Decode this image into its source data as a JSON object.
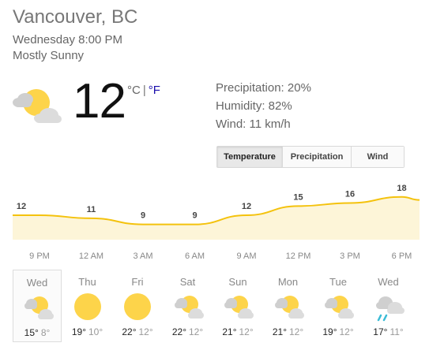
{
  "location": "Vancouver, BC",
  "datetime": "Wednesday 8:00 PM",
  "condition": "Mostly Sunny",
  "current": {
    "temp": "12",
    "unit_c": "°C",
    "unit_sep": "|",
    "unit_f": "°F",
    "icon": "partly-sunny-icon"
  },
  "details": {
    "precipitation": "Precipitation: 20%",
    "humidity": "Humidity: 82%",
    "wind": "Wind: 11 km/h"
  },
  "tabs": [
    {
      "label": "Temperature",
      "active": true
    },
    {
      "label": "Precipitation",
      "active": false
    },
    {
      "label": "Wind",
      "active": false
    }
  ],
  "chart_data": {
    "type": "area",
    "x": [
      "9 PM",
      "12 AM",
      "3 AM",
      "6 AM",
      "9 AM",
      "12 PM",
      "3 PM",
      "6 PM"
    ],
    "labeled_points": [
      {
        "x": "9 PM",
        "label": "12",
        "y": 12
      },
      {
        "x": "12 AM",
        "label": "11",
        "y": 11
      },
      {
        "x": "3 AM",
        "label": "9",
        "y": 9
      },
      {
        "x": "6 AM",
        "label": "9",
        "y": 9
      },
      {
        "x": "9 AM",
        "label": "12",
        "y": 12
      },
      {
        "x": "12 PM",
        "label": "15",
        "y": 15
      },
      {
        "x": "3 PM",
        "label": "16",
        "y": 16
      },
      {
        "x": "6 PM",
        "label": "18",
        "y": 18
      }
    ],
    "line_color": "#f4c20d",
    "fill_color": "#fdf5d8"
  },
  "forecast": [
    {
      "day": "Wed",
      "hi": "15°",
      "lo": "8°",
      "icon": "partly-sunny-icon",
      "selected": true
    },
    {
      "day": "Thu",
      "hi": "19°",
      "lo": "10°",
      "icon": "sunny-icon",
      "selected": false
    },
    {
      "day": "Fri",
      "hi": "22°",
      "lo": "12°",
      "icon": "sunny-icon",
      "selected": false
    },
    {
      "day": "Sat",
      "hi": "22°",
      "lo": "12°",
      "icon": "partly-sunny-icon",
      "selected": false
    },
    {
      "day": "Sun",
      "hi": "21°",
      "lo": "12°",
      "icon": "partly-sunny-icon",
      "selected": false
    },
    {
      "day": "Mon",
      "hi": "21°",
      "lo": "12°",
      "icon": "partly-sunny-icon",
      "selected": false
    },
    {
      "day": "Tue",
      "hi": "19°",
      "lo": "12°",
      "icon": "partly-sunny-icon",
      "selected": false
    },
    {
      "day": "Wed",
      "hi": "17°",
      "lo": "11°",
      "icon": "rain-cloud-icon",
      "selected": false
    }
  ]
}
